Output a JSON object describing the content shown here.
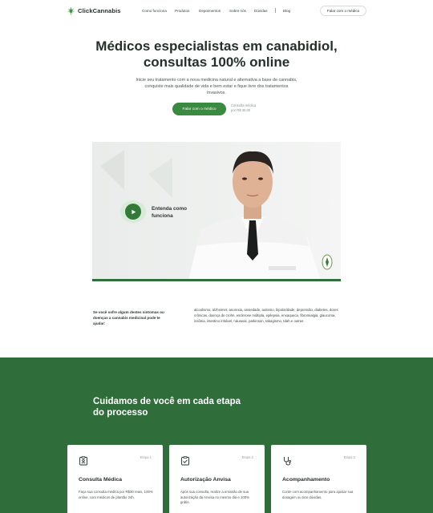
{
  "nav": {
    "logo_text": "ClickCannabis",
    "links": [
      "Como funciona",
      "Produtos",
      "Depoimentos",
      "Sobre nós",
      "Dúvidas"
    ],
    "blog": "Blog",
    "cta": "Falar com o médico"
  },
  "hero": {
    "title_line1": "Médicos especialistas em canabidiol,",
    "title_line2": "consultas 100% online",
    "subtitle": "Inicie seu tratamento com a nova medicina natural e alternativa a base de cannabis, conquiste mais qualidade de vida e bem estar e fique livre dos tratamentos invasivos.",
    "cta": "Falar com o médico",
    "price_line1": "Consulta médica",
    "price_line2": "por R$ 30,00"
  },
  "video": {
    "label": "Entenda como funciona",
    "play_icon": "play-icon"
  },
  "symptoms": {
    "title": "Se você sofre algum destes sintomas ou doenças a cannabis medicinal pode te ajudar:",
    "text": "alcoolismo, alzheimer, anorexia, ansiedade, autismo, bipolaridade, depressão, diabetes, dores crônicas, doença de crohn, esclerose múltipla, epilepsia, enxaqueca, fibromialgia, glaucoma, insônia, intestino irritável, náuseas, parkinson, tabagismo, tdah e outras"
  },
  "process": {
    "title": "Cuidamos de você em cada etapa do processo",
    "cards": [
      {
        "step": "Etapa 1",
        "title": "Consulta Médica",
        "text": "Faça sua consulta médica por R$30 reais, 100% online, com médicos de plantão 24h.",
        "icon": "clipboard-icon"
      },
      {
        "step": "Etapa 2",
        "title": "Autorização Anvisa",
        "text": "Após sua consulta, realize a emissão de sua autorização da Anvisa no mesmo dia e 100% grátis.",
        "icon": "document-check-icon"
      },
      {
        "step": "Etapa 3",
        "title": "Acompanhamento",
        "text": "Conte com acompanhamento para ajustar sua dosagem ou tirar dúvidas.",
        "icon": "stethoscope-icon"
      }
    ]
  },
  "colors": {
    "brand_green": "#3a8a3f",
    "section_green": "#2f6e3b"
  }
}
